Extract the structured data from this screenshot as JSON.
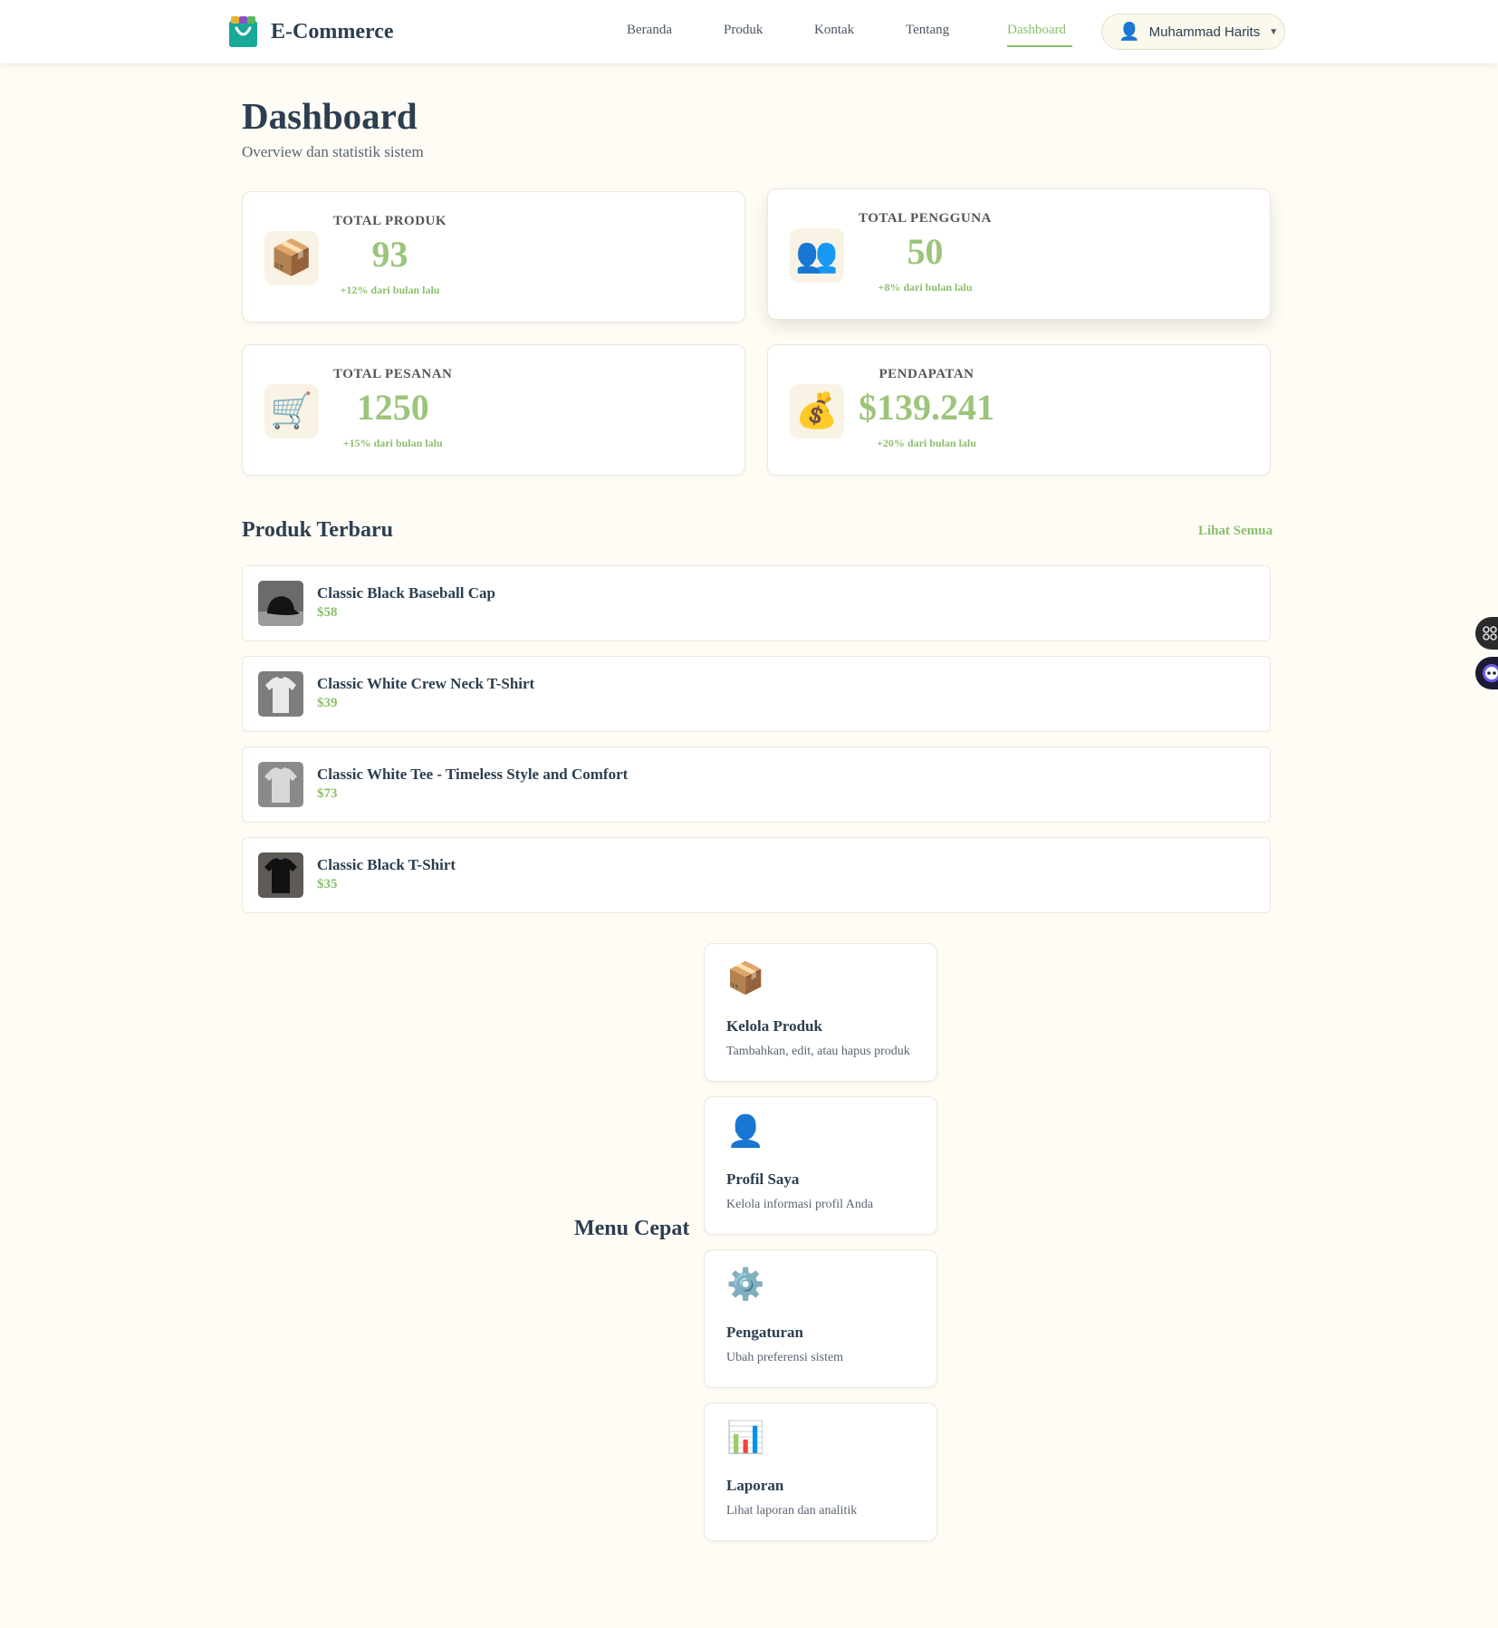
{
  "brand": {
    "name": "E-Commerce",
    "logo_icon": "shopping-bag-icon"
  },
  "nav": {
    "links": [
      "Beranda",
      "Produk",
      "Kontak",
      "Tentang",
      "Dashboard"
    ],
    "active": "Dashboard",
    "user": {
      "name": "Muhammad Harits",
      "icon": "user-icon",
      "caret": "▼"
    }
  },
  "page": {
    "title": "Dashboard",
    "subtitle": "Overview dan statistik sistem"
  },
  "stats": [
    {
      "label": "TOTAL PRODUK",
      "value": "93",
      "change": "+12% dari bulan lalu",
      "icon": "📦"
    },
    {
      "label": "TOTAL PENGGUNA",
      "value": "50",
      "change": "+8% dari bulan lalu",
      "icon": "👥"
    },
    {
      "label": "TOTAL PESANAN",
      "value": "1250",
      "change": "+15% dari bulan lalu",
      "icon": "🛒"
    },
    {
      "label": "PENDAPATAN",
      "value": "$139.241",
      "change": "+20% dari bulan lalu",
      "icon": "💰"
    }
  ],
  "latest_products": {
    "title": "Produk Terbaru",
    "see_all": "Lihat Semua",
    "items": [
      {
        "name": "Classic Black Baseball Cap",
        "price": "$58"
      },
      {
        "name": "Classic White Crew Neck T-Shirt",
        "price": "$39"
      },
      {
        "name": "Classic White Tee - Timeless Style and Comfort",
        "price": "$73"
      },
      {
        "name": "Classic Black T-Shirt",
        "price": "$35"
      }
    ]
  },
  "quick_menu": {
    "title": "Menu Cepat",
    "items": [
      {
        "name": "Kelola Produk",
        "desc": "Tambahkan, edit, atau hapus produk",
        "icon": "📦"
      },
      {
        "name": "Profil Saya",
        "desc": "Kelola informasi profil Anda",
        "icon": "👤"
      },
      {
        "name": "Pengaturan",
        "desc": "Ubah preferensi sistem",
        "icon": "⚙️"
      },
      {
        "name": "Laporan",
        "desc": "Lihat laporan dan analitik",
        "icon": "📊"
      }
    ]
  },
  "colors": {
    "accent": "#8bbf6a",
    "value": "#9cc47a",
    "text": "#2c3e50",
    "background": "#fefcf5"
  }
}
